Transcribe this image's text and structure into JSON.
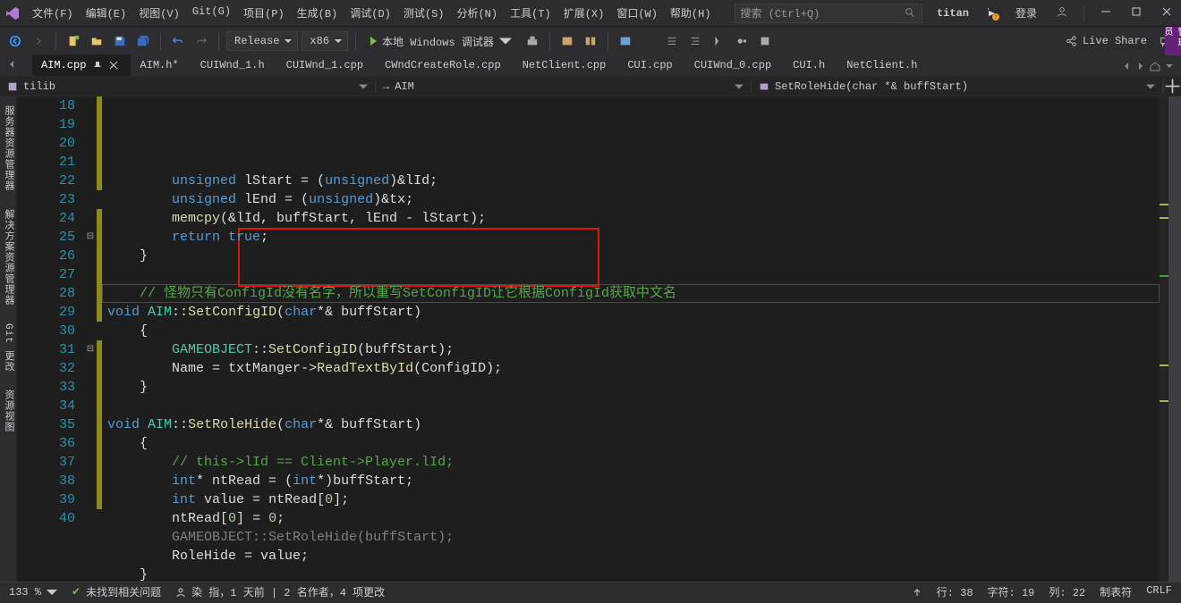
{
  "menus": [
    "文件(F)",
    "编辑(E)",
    "视图(V)",
    "Git(G)",
    "项目(P)",
    "生成(B)",
    "调试(D)",
    "测试(S)",
    "分析(N)",
    "工具(T)",
    "扩展(X)",
    "窗口(W)",
    "帮助(H)"
  ],
  "search_placeholder": "搜索 (Ctrl+Q)",
  "solution_name": "titan",
  "signin": "登录",
  "admin_label": "管理员",
  "config": "Release",
  "platform": "x86",
  "debug_target": "本地 Windows 调试器",
  "liveshare": "Live Share",
  "doc_tabs": [
    "AIM.cpp",
    "AIM.h*",
    "CUIWnd_1.h",
    "CUIWnd_1.cpp",
    "CWndCreateRole.cpp",
    "NetClient.cpp",
    "CUI.cpp",
    "CUIWnd_0.cpp",
    "CUI.h",
    "NetClient.h"
  ],
  "nav_left": "tilib",
  "nav_mid": "AIM",
  "nav_right": "SetRoleHide(char *& buffStart)",
  "vtabs": [
    "服务器资源管理器",
    "解决方案资源管理器",
    "Git 更改",
    "资源视图"
  ],
  "lines": [
    18,
    19,
    20,
    21,
    22,
    23,
    24,
    25,
    26,
    27,
    28,
    29,
    30,
    31,
    32,
    33,
    34,
    35,
    36,
    37,
    38,
    39,
    40
  ],
  "folds": {
    "25": "⊟",
    "31": "⊟"
  },
  "marks": {
    "18": "y",
    "19": "y",
    "20": "y",
    "21": "y",
    "22": "y",
    "24": "y",
    "25": "y",
    "26": "y",
    "27": "y",
    "28": "y",
    "29": "y",
    "31": "y",
    "32": "y",
    "33": "y",
    "34": "y",
    "35": "y",
    "36": "y",
    "37": "y",
    "38": "y",
    "39": "y"
  },
  "code": {
    "18": [
      [
        "        ",
        ""
      ],
      [
        "unsigned",
        "kw"
      ],
      [
        " lStart ",
        ""
      ],
      [
        "=",
        "op"
      ],
      [
        " (",
        ""
      ],
      [
        "unsigned",
        "kw"
      ],
      [
        ")&lId;",
        ""
      ]
    ],
    "19": [
      [
        "        ",
        ""
      ],
      [
        "unsigned",
        "kw"
      ],
      [
        " lEnd ",
        ""
      ],
      [
        "=",
        "op"
      ],
      [
        " (",
        ""
      ],
      [
        "unsigned",
        "kw"
      ],
      [
        ")&tx;",
        ""
      ]
    ],
    "20": [
      [
        "        ",
        ""
      ],
      [
        "memcpy",
        "fn"
      ],
      [
        "(&lId, buffStart, lEnd ",
        ""
      ],
      [
        "-",
        "op"
      ],
      [
        " lStart);",
        ""
      ]
    ],
    "21": [
      [
        "        ",
        ""
      ],
      [
        "return",
        "kw"
      ],
      [
        " ",
        ""
      ],
      [
        "true",
        "kw"
      ],
      [
        ";",
        ""
      ]
    ],
    "22": [
      [
        "    }",
        "brace"
      ]
    ],
    "23": [
      [
        "",
        ""
      ]
    ],
    "24": [
      [
        "    ",
        ""
      ],
      [
        "// 怪物只有ConfigId没有名字，所以重写SetConfigID让它根据ConfigId获取中文名",
        "cm"
      ]
    ],
    "25": [
      [
        "",
        ""
      ],
      [
        "void",
        "kw"
      ],
      [
        " ",
        ""
      ],
      [
        "AIM",
        "cls"
      ],
      [
        "::",
        "op"
      ],
      [
        "SetConfigID",
        "fn"
      ],
      [
        "(",
        ""
      ],
      [
        "char",
        "kw"
      ],
      [
        "*& buffStart)",
        ""
      ]
    ],
    "26": [
      [
        "    {",
        "brace"
      ]
    ],
    "27": [
      [
        "        ",
        ""
      ],
      [
        "GAMEOBJECT",
        "cls"
      ],
      [
        "::",
        "op"
      ],
      [
        "SetConfigID",
        "fn"
      ],
      [
        "(buffStart);",
        ""
      ]
    ],
    "28": [
      [
        "        Name ",
        ""
      ],
      [
        "=",
        "op"
      ],
      [
        " txtManger",
        ""
      ],
      [
        "->",
        "op"
      ],
      [
        "",
        ""
      ],
      [
        "ReadTextById",
        "fn"
      ],
      [
        "(ConfigID);",
        ""
      ]
    ],
    "29": [
      [
        "    }",
        "brace"
      ]
    ],
    "30": [
      [
        "",
        ""
      ]
    ],
    "31": [
      [
        "",
        ""
      ],
      [
        "void",
        "kw"
      ],
      [
        " ",
        ""
      ],
      [
        "AIM",
        "cls"
      ],
      [
        "::",
        "op"
      ],
      [
        "SetRoleHide",
        "fn"
      ],
      [
        "(",
        ""
      ],
      [
        "char",
        "kw"
      ],
      [
        "*& buffStart)",
        ""
      ]
    ],
    "32": [
      [
        "    {",
        "brace"
      ]
    ],
    "33": [
      [
        "        ",
        ""
      ],
      [
        "// this->lId == Client->Player.lId;",
        "cm"
      ]
    ],
    "34": [
      [
        "        ",
        ""
      ],
      [
        "int",
        "kw"
      ],
      [
        "* ntRead ",
        ""
      ],
      [
        "=",
        "op"
      ],
      [
        " (",
        ""
      ],
      [
        "int",
        "kw"
      ],
      [
        "*)buffStart;",
        ""
      ]
    ],
    "35": [
      [
        "        ",
        ""
      ],
      [
        "int",
        "kw"
      ],
      [
        " value ",
        ""
      ],
      [
        "=",
        "op"
      ],
      [
        " ntRead[",
        ""
      ],
      [
        "0",
        "num"
      ],
      [
        "];",
        ""
      ]
    ],
    "36": [
      [
        "        ntRead[",
        ""
      ],
      [
        "0",
        "num"
      ],
      [
        "] ",
        ""
      ],
      [
        "=",
        "op"
      ],
      [
        " ",
        ""
      ],
      [
        "0",
        "num"
      ],
      [
        ";",
        ""
      ]
    ],
    "37": [
      [
        "        ",
        ""
      ],
      [
        "GAMEOBJECT",
        "pale"
      ],
      [
        "::",
        "pale"
      ],
      [
        "SetRoleHide",
        "pale"
      ],
      [
        "(buffStart);",
        "pale"
      ]
    ],
    "38": [
      [
        "        RoleHide ",
        ""
      ],
      [
        "=",
        "op"
      ],
      [
        " value;",
        ""
      ]
    ],
    "39": [
      [
        "    }",
        "brace"
      ]
    ],
    "40": [
      [
        "",
        ""
      ]
    ]
  },
  "status": {
    "zoom": "133 %",
    "noissues": "未找到相关问题",
    "blame": "染 指，1 天前 | 2 名作者，4 项更改",
    "line": "行: 38",
    "char": "字符: 19",
    "col": "列: 22",
    "tabmode": "制表符",
    "eol": "CRLF"
  }
}
